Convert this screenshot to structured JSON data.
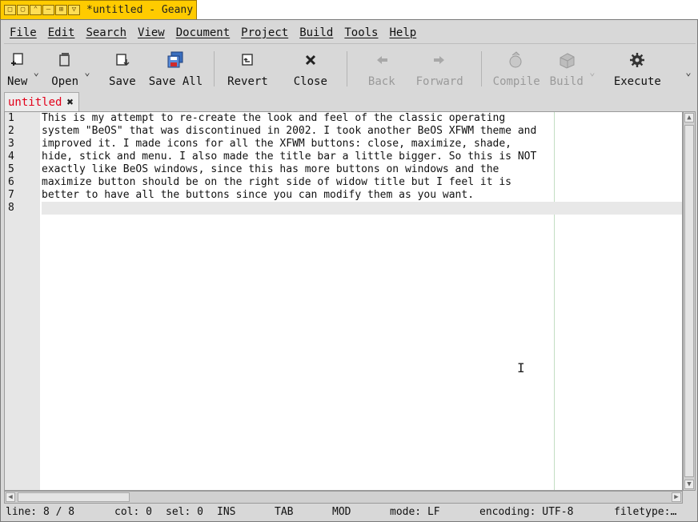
{
  "window": {
    "title": "*untitled - Geany",
    "controls": [
      "□",
      "▢",
      "⌃",
      "—",
      "⊞",
      "▽"
    ]
  },
  "menu": [
    "File",
    "Edit",
    "Search",
    "View",
    "Document",
    "Project",
    "Build",
    "Tools",
    "Help"
  ],
  "toolbar": {
    "new": "New",
    "open": "Open",
    "save": "Save",
    "save_all": "Save All",
    "revert": "Revert",
    "close": "Close",
    "back": "Back",
    "forward": "Forward",
    "compile": "Compile",
    "build": "Build",
    "execute": "Execute"
  },
  "tab": {
    "name": "untitled",
    "close": "✖"
  },
  "editor": {
    "line_numbers": [
      "1",
      "2",
      "3",
      "4",
      "5",
      "6",
      "7",
      "8"
    ],
    "lines": [
      "This is my attempt to re-create the look and feel of the classic operating",
      "system \"BeOS\" that was discontinued in 2002. I took another BeOS XFWM theme and",
      "improved it. I made icons for all the XFWM buttons: close, maximize, shade,",
      "hide, stick and menu. I also made the title bar a little bigger. So this is NOT",
      "exactly like BeOS windows, since this has more buttons on windows and the",
      "maximize button should be on the right side of widow title but I feel it is",
      "better to have all the buttons since you can modify them as you want.",
      ""
    ]
  },
  "status": {
    "line": "line: 8 / 8",
    "col": "col: 0",
    "sel": "sel: 0",
    "ins": "INS",
    "tab": "TAB",
    "mod": "MOD",
    "mode": "mode: LF",
    "encoding": "encoding: UTF-8",
    "filetype": "filetype:…"
  },
  "colors": {
    "title_tab": "#ffcb00",
    "tab_name": "#e2001a"
  }
}
